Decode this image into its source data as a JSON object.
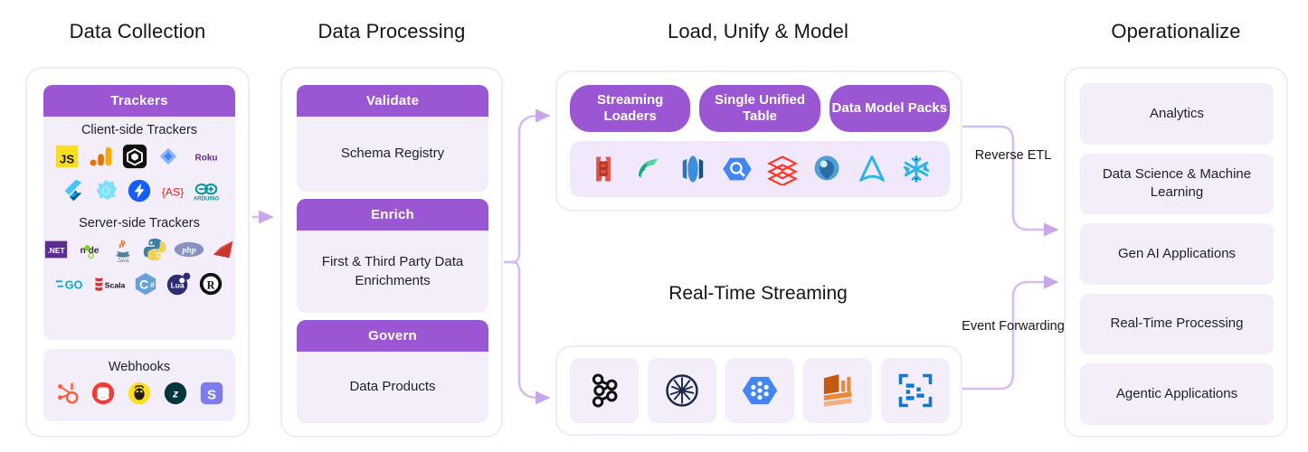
{
  "columns": [
    {
      "title": "Data Collection"
    },
    {
      "title": "Data Processing"
    },
    {
      "title": "Load, Unify & Model"
    },
    {
      "title": "Operationalize"
    }
  ],
  "data_collection": {
    "trackers_card": {
      "header": "Trackers",
      "client_label": "Client-side Trackers",
      "client_icons": [
        "javascript-icon",
        "google-analytics-icon",
        "unity-icon",
        "google-tag-manager-icon",
        "roku-icon",
        "flutter-icon",
        "blazor-icon",
        "amp-icon",
        "actionscript-icon",
        "arduino-icon"
      ],
      "server_label": "Server-side Trackers",
      "server_icons": [
        "dotnet-icon",
        "nodejs-icon",
        "java-icon",
        "python-icon",
        "php-icon",
        "ruby-icon",
        "golang-icon",
        "scala-icon",
        "csharp-icon",
        "lua-icon",
        "rust-icon"
      ]
    },
    "webhooks_card": {
      "label": "Webhooks",
      "icons": [
        "hubspot-icon",
        "intercom-icon",
        "mailchimp-icon",
        "zendesk-icon",
        "sendgrid-icon"
      ]
    }
  },
  "data_processing": {
    "cards": [
      {
        "header": "Validate",
        "body": "Schema Registry"
      },
      {
        "header": "Enrich",
        "body": "First & Third Party Data Enrichments"
      },
      {
        "header": "Govern",
        "body": "Data Products"
      }
    ]
  },
  "load_unify_model": {
    "pills": [
      "Streaming Loaders",
      "Single Unified Table",
      "Data Model Packs"
    ],
    "logos": [
      "amazon-s3-icon",
      "microsoft-fabric-icon",
      "amazon-redshift-icon",
      "google-bigquery-icon",
      "databricks-icon",
      "trino-icon",
      "apache-druid-icon",
      "snowflake-icon"
    ]
  },
  "real_time_streaming": {
    "title": "Real-Time Streaming",
    "logos": [
      "apache-kafka-icon",
      "apache-pulsar-icon",
      "google-pubsub-icon",
      "amazon-kinesis-icon",
      "azure-event-hubs-icon"
    ]
  },
  "operationalize": {
    "items": [
      "Analytics",
      "Data Science & Machine Learning",
      "Gen AI Applications",
      "Real-Time Processing",
      "Agentic Applications"
    ]
  },
  "connectors": {
    "reverse_etl": "Reverse ETL",
    "event_forwarding": "Event Forwarding"
  },
  "colors": {
    "purple": "#9b57d3",
    "lavender_fill": "#f4eefb",
    "shell_border": "#f0eaf9",
    "wire": "#c9a6e8",
    "text": "#1d2024"
  }
}
